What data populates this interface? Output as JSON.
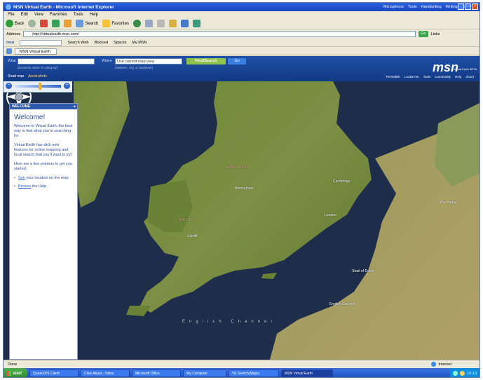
{
  "window": {
    "title": "MSN Virtual Earth - Microsoft Internet Explorer",
    "toolbar_right": [
      "Microphone",
      "Tools",
      "Handwriting",
      "Writing Pad"
    ]
  },
  "menu": [
    "File",
    "Edit",
    "View",
    "Favorites",
    "Tools",
    "Help"
  ],
  "toolbar": {
    "back_label": "Back",
    "search_label": "Search",
    "favorites_label": "Favorites"
  },
  "address": {
    "label": "Address",
    "url": "http://virtualearth.msn.com/",
    "go_label": "Go",
    "links_label": "Links"
  },
  "msnbar": {
    "logo": "msn",
    "search_web_label": "Search Web",
    "blocked_label": "Blocked",
    "spaces_label": "Spaces",
    "mymsn_label": "My MSN"
  },
  "tab": {
    "label": "MSN Virtual Earth"
  },
  "ve": {
    "what_label": "What",
    "what_hint": "(business name or category)",
    "where_label": "Where",
    "where_value": "Use current map view",
    "where_hint": "(address, city, or landmark)",
    "find_label": "Find/Search",
    "go_label": "Go",
    "view_road": "Road map",
    "view_aerial": "Aerial photo",
    "logo": "msn",
    "logo_sub": "Virtual Earth BETA",
    "links": [
      "Permalink",
      "Locate me",
      "Tools",
      "Community",
      "Help",
      "About"
    ]
  },
  "welcome": {
    "header": "WELCOME",
    "title": "Welcome!",
    "p1": "Welcome to Virtual Earth, the best way to find what you're searching for.",
    "p2": "Virtual Earth has slick new features for online mapping and local search that you'll want to try!",
    "p3": "Here are a few pointers to get you started:",
    "item1_link": "See",
    "item1_text": " your location on the map.",
    "item2_link": "Browse",
    "item2_text": " the Help."
  },
  "map": {
    "sea_label": "English Channel",
    "labels": {
      "london": "London",
      "cambridge": "Cambridge",
      "birmingham": "Birmingham",
      "cardiff": "Cardiff",
      "england": "ENGLAND",
      "wales": "WALES",
      "english_channel_fr": "English Channel",
      "the_hague": "The Hague",
      "strait": "Strait of Dover"
    }
  },
  "status": {
    "text": "Done",
    "zone": "Internet"
  },
  "taskbar": {
    "start": "start",
    "tasks": [
      "QuarkXPS Client",
      "Clive Akass - Inbox",
      "Microsoft Office",
      "My Computer",
      "VE Search(Maps)",
      "MSN Virtual Earth"
    ],
    "tray_time": "10:13"
  }
}
